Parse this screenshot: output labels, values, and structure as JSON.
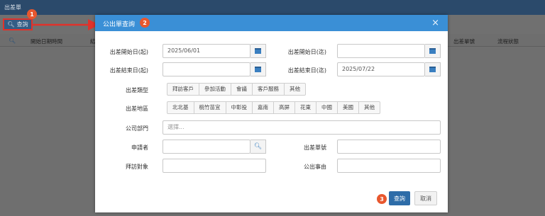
{
  "app": {
    "title": "出差單"
  },
  "toolbar": {
    "search_label": "查詢"
  },
  "table": {
    "headers": [
      "開始日期時間",
      "結",
      "出差單號",
      "流程狀態"
    ]
  },
  "callouts": [
    "1",
    "2",
    "3"
  ],
  "modal": {
    "title": "公出單查詢",
    "close": "×",
    "labels": {
      "start_from": "出差開始日(起)",
      "start_to": "出差開始日(迄)",
      "end_from": "出差結束日(起)",
      "end_to": "出差結束日(迄)",
      "trip_type": "出差類型",
      "trip_area": "出差地區",
      "department": "公司部門",
      "applicant": "申請者",
      "trip_no": "出差單號",
      "visit_target": "拜訪對象",
      "reason": "公出事由"
    },
    "values": {
      "start_from": "2025/06/01",
      "start_to": "",
      "end_from": "",
      "end_to": "2025/07/22",
      "applicant": "",
      "trip_no": "",
      "visit_target": "",
      "reason": ""
    },
    "department_placeholder": "選擇...",
    "trip_types": [
      "拜訪客戶",
      "參加活動",
      "會議",
      "客戶服務",
      "其他"
    ],
    "trip_areas": [
      "北北基",
      "桃竹苗宜",
      "中彰投",
      "嘉南",
      "高屏",
      "花東",
      "中國",
      "美國",
      "其他"
    ],
    "query_label": "查詢",
    "cancel_label": "取消"
  },
  "colors": {
    "accent": "#3a8fd6",
    "primary_button": "#2d6ca8",
    "callout": "#e8572e",
    "arrow": "#e0322b"
  }
}
